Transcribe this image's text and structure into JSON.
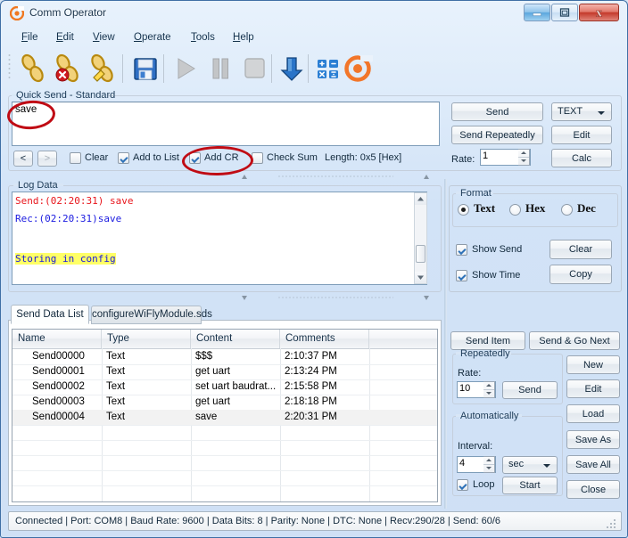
{
  "window": {
    "title": "Comm Operator",
    "app_icon": "comm-operator-logo-icon",
    "controls": {
      "minimize": "minimize-icon",
      "maximize": "maximize-icon",
      "close": "close-icon"
    }
  },
  "menubar": {
    "items": [
      {
        "label": "File",
        "accel": "F"
      },
      {
        "label": "Edit",
        "accel": "E"
      },
      {
        "label": "View",
        "accel": "V"
      },
      {
        "label": "Operate",
        "accel": "O"
      },
      {
        "label": "Tools",
        "accel": "T"
      },
      {
        "label": "Help",
        "accel": "H"
      }
    ]
  },
  "toolbar": {
    "items": [
      {
        "name": "connect-icon",
        "title": "Connect"
      },
      {
        "name": "disconnect-icon",
        "title": "Disconnect"
      },
      {
        "name": "edit-connection-icon",
        "title": "Edit Connection"
      },
      {
        "name": "save-icon",
        "title": "Save"
      },
      {
        "name": "play-icon",
        "title": "Start"
      },
      {
        "name": "pause-icon",
        "title": "Pause"
      },
      {
        "name": "stop-icon",
        "title": "Stop"
      },
      {
        "name": "download-arrow-icon",
        "title": "Receive"
      },
      {
        "name": "calculator-icon",
        "title": "Calculator"
      },
      {
        "name": "comm-operator-logo-icon",
        "title": "About"
      }
    ]
  },
  "quick_send": {
    "group_label": "Quick Send - Standard",
    "input_value": "save",
    "prev_label": "<",
    "next_label": ">",
    "checkboxes": [
      {
        "label": "Clear",
        "checked": false
      },
      {
        "label": "Add to List",
        "checked": true
      },
      {
        "label": "Add CR",
        "checked": true
      },
      {
        "label": "Check Sum",
        "checked": false
      }
    ],
    "length_label": "Length: 0x5 [Hex]",
    "send_label": "Send",
    "send_repeatedly_label": "Send Repeatedly",
    "rate_label": "Rate:",
    "rate_value": "1",
    "format_combo_value": "TEXT",
    "edit_label": "Edit",
    "calc_label": "Calc"
  },
  "log": {
    "group_label": "Log Data",
    "lines": [
      {
        "text": "Send:(02:20:31) save",
        "color": "#e8161c",
        "highlight": false
      },
      {
        "text": "Rec:(02:20:31)save",
        "color": "#1a1ae0",
        "highlight": false
      },
      {
        "text": "Storing in config",
        "color": "#1a1ae0",
        "highlight": true
      }
    ],
    "highlight_color": "#ffff66"
  },
  "format": {
    "group_label": "Format",
    "options": [
      {
        "label": "Text",
        "selected": true
      },
      {
        "label": "Hex",
        "selected": false
      },
      {
        "label": "Dec",
        "selected": false
      }
    ],
    "show_send": {
      "label": "Show Send",
      "checked": true
    },
    "show_time": {
      "label": "Show Time",
      "checked": true
    },
    "clear_label": "Clear",
    "copy_label": "Copy"
  },
  "send_data_list": {
    "tabs": [
      {
        "label": "Send Data List",
        "active": true
      },
      {
        "label": "configureWiFlyModule.sds",
        "active": false
      }
    ],
    "columns": [
      "Name",
      "Type",
      "Content",
      "Comments"
    ],
    "rows": [
      {
        "name": "Send00000",
        "type": "Text",
        "content": "$$$",
        "comments": "2:10:37 PM",
        "selected": false
      },
      {
        "name": "Send00001",
        "type": "Text",
        "content": "get uart",
        "comments": "2:13:24 PM",
        "selected": false
      },
      {
        "name": "Send00002",
        "type": "Text",
        "content": "set uart baudrat...",
        "comments": "2:15:58 PM",
        "selected": false
      },
      {
        "name": "Send00003",
        "type": "Text",
        "content": "get uart",
        "comments": "2:18:18 PM",
        "selected": false
      },
      {
        "name": "Send00004",
        "type": "Text",
        "content": "save",
        "comments": "2:20:31 PM",
        "selected": true
      }
    ]
  },
  "right_panel": {
    "send_item_label": "Send Item",
    "send_go_next_label": "Send & Go Next",
    "repeatedly": {
      "group_label": "Repeatedly",
      "rate_label": "Rate:",
      "rate_value": "10",
      "send_label": "Send"
    },
    "automatically": {
      "group_label": "Automatically",
      "interval_label": "Interval:",
      "interval_value": "4",
      "unit_value": "sec",
      "loop_label": "Loop",
      "loop_checked": true,
      "start_label": "Start"
    },
    "buttons": [
      {
        "label": "New"
      },
      {
        "label": "Edit"
      },
      {
        "label": "Load"
      },
      {
        "label": "Save As"
      },
      {
        "label": "Save All"
      },
      {
        "label": "Close"
      }
    ]
  },
  "statusbar": {
    "text": "Connected | Port: COM8 | Baud Rate: 9600 | Data Bits: 8 | Parity: None | DTC: None | Recv:290/28 | Send: 60/6"
  },
  "annotations": {
    "accent_color": "#c00b14",
    "marks": [
      {
        "target": "quick-send-input-value"
      },
      {
        "target": "add-cr-checkbox"
      }
    ]
  }
}
